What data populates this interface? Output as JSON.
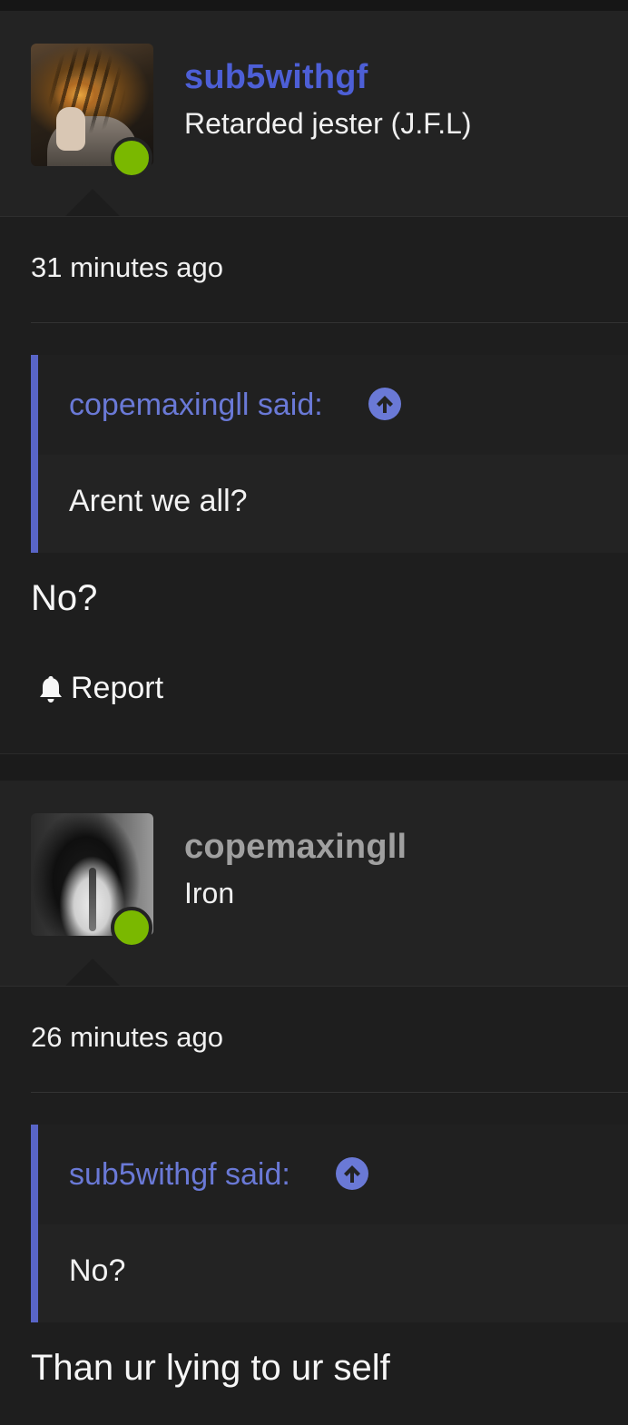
{
  "posts": [
    {
      "username": "sub5withgf",
      "username_color": "#4d5fd6",
      "user_title": "Retarded jester (J.F.L)",
      "avatar_icon": "tiger-avatar",
      "timestamp": "31 minutes ago",
      "quote": {
        "author_label": "copemaxingll said:",
        "text": "Arent we all?"
      },
      "reply": "No?",
      "report_label": "Report"
    },
    {
      "username": "copemaxingll",
      "username_color": "#a0a0a0",
      "user_title": "Iron",
      "avatar_icon": "bird-avatar",
      "timestamp": "26 minutes ago",
      "quote": {
        "author_label": "sub5withgf said:",
        "text": "No?"
      },
      "reply": "Than ur lying to ur self"
    }
  ],
  "colors": {
    "online": "#7ab800",
    "quote_accent": "#5965c7",
    "quote_author": "#6a79d6"
  }
}
